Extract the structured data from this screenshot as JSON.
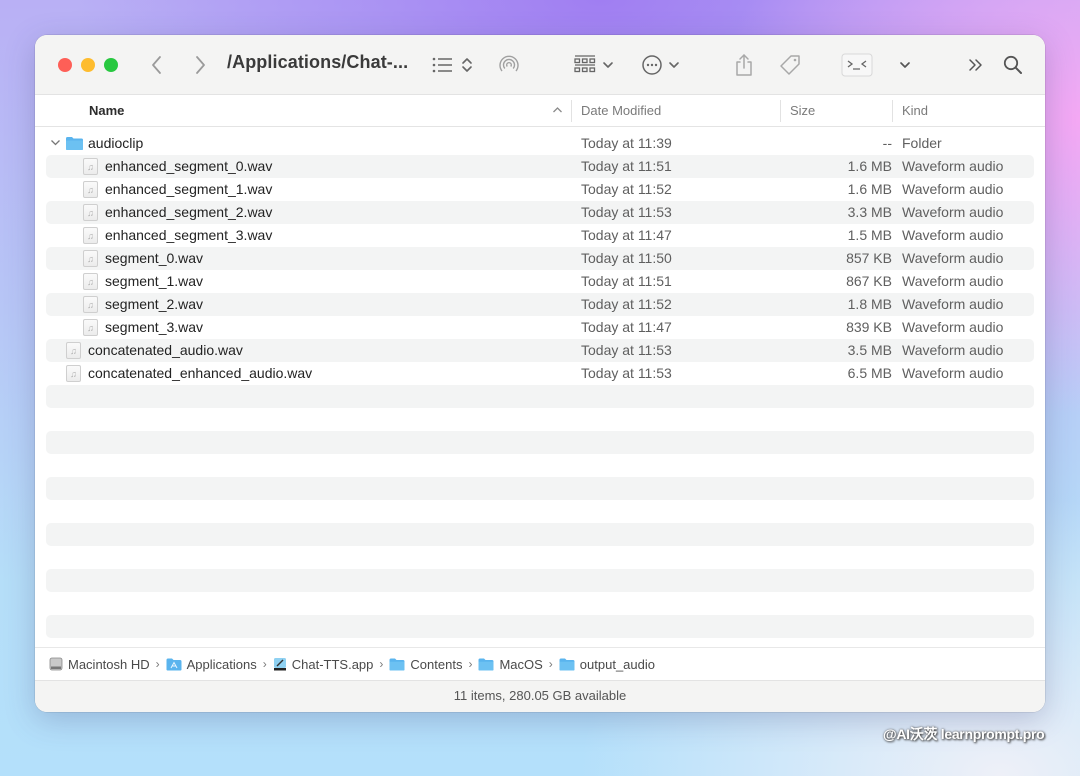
{
  "window": {
    "title": "/Applications/Chat-...",
    "toolbar": {
      "back": "back",
      "forward": "forward",
      "view_options": "list-view",
      "airdrop": "airdrop",
      "group": "group-by",
      "action": "more-actions",
      "share": "share",
      "tag": "tag",
      "terminal": "terminal",
      "more": "more-toolbar-items",
      "search": "search"
    }
  },
  "columns": {
    "name": "Name",
    "date": "Date Modified",
    "size": "Size",
    "kind": "Kind"
  },
  "rows": [
    {
      "name": "audioclip",
      "date": "Today at 11:39",
      "size": "--",
      "kind": "Folder",
      "type": "folder",
      "level": 0,
      "expanded": true
    },
    {
      "name": "enhanced_segment_0.wav",
      "date": "Today at 11:51",
      "size": "1.6 MB",
      "kind": "Waveform audio",
      "type": "file",
      "level": 1
    },
    {
      "name": "enhanced_segment_1.wav",
      "date": "Today at 11:52",
      "size": "1.6 MB",
      "kind": "Waveform audio",
      "type": "file",
      "level": 1
    },
    {
      "name": "enhanced_segment_2.wav",
      "date": "Today at 11:53",
      "size": "3.3 MB",
      "kind": "Waveform audio",
      "type": "file",
      "level": 1
    },
    {
      "name": "enhanced_segment_3.wav",
      "date": "Today at 11:47",
      "size": "1.5 MB",
      "kind": "Waveform audio",
      "type": "file",
      "level": 1
    },
    {
      "name": "segment_0.wav",
      "date": "Today at 11:50",
      "size": "857 KB",
      "kind": "Waveform audio",
      "type": "file",
      "level": 1
    },
    {
      "name": "segment_1.wav",
      "date": "Today at 11:51",
      "size": "867 KB",
      "kind": "Waveform audio",
      "type": "file",
      "level": 1
    },
    {
      "name": "segment_2.wav",
      "date": "Today at 11:52",
      "size": "1.8 MB",
      "kind": "Waveform audio",
      "type": "file",
      "level": 1
    },
    {
      "name": "segment_3.wav",
      "date": "Today at 11:47",
      "size": "839 KB",
      "kind": "Waveform audio",
      "type": "file",
      "level": 1
    },
    {
      "name": "concatenated_audio.wav",
      "date": "Today at 11:53",
      "size": "3.5 MB",
      "kind": "Waveform audio",
      "type": "file",
      "level": 0
    },
    {
      "name": "concatenated_enhanced_audio.wav",
      "date": "Today at 11:53",
      "size": "6.5 MB",
      "kind": "Waveform audio",
      "type": "file",
      "level": 0
    }
  ],
  "pathbar": [
    {
      "label": "Macintosh HD",
      "icon": "disk-icon"
    },
    {
      "label": "Applications",
      "icon": "applications-folder-icon"
    },
    {
      "label": "Chat-TTS.app",
      "icon": "app-icon"
    },
    {
      "label": "Contents",
      "icon": "folder-icon"
    },
    {
      "label": "MacOS",
      "icon": "folder-icon"
    },
    {
      "label": "output_audio",
      "icon": "folder-icon"
    }
  ],
  "status": "11 items, 280.05 GB available",
  "watermark": "@AI沃茨 learnprompt.pro",
  "colors": {
    "folder": "#5ab4ee",
    "close": "#fe5f57",
    "minimize": "#febc2e",
    "zoom": "#28c840"
  }
}
